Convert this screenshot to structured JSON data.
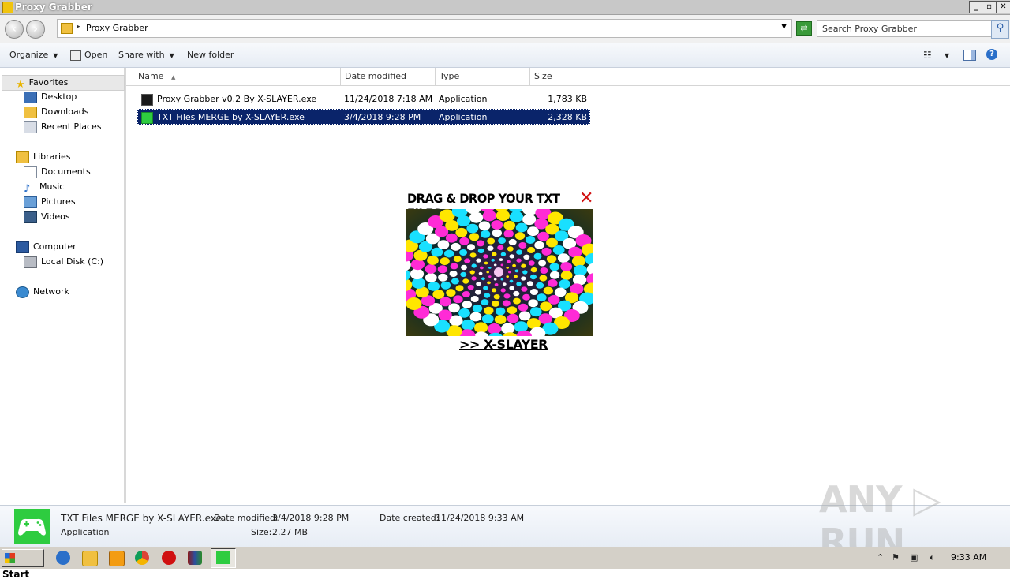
{
  "window": {
    "title": "Proxy Grabber",
    "controls": {
      "minimize": "_",
      "maximize": "▫",
      "close": "✕"
    }
  },
  "address": {
    "breadcrumb": "Proxy Grabber",
    "search_placeholder": "Search Proxy Grabber"
  },
  "toolbar": {
    "organize": "Organize",
    "open": "Open",
    "share_with": "Share with",
    "new_folder": "New folder"
  },
  "nav": {
    "favorites": "Favorites",
    "desktop": "Desktop",
    "downloads": "Downloads",
    "recent_places": "Recent Places",
    "libraries": "Libraries",
    "documents": "Documents",
    "music": "Music",
    "pictures": "Pictures",
    "videos": "Videos",
    "computer": "Computer",
    "local_disk": "Local Disk (C:)",
    "network": "Network"
  },
  "columns": {
    "name": "Name",
    "date": "Date modified",
    "type": "Type",
    "size": "Size"
  },
  "files": [
    {
      "name": "Proxy Grabber v0.2 By X-SLAYER.exe",
      "date": "11/24/2018 7:18 AM",
      "type": "Application",
      "size": "1,783 KB"
    },
    {
      "name": "TXT Files MERGE by X-SLAYER.exe",
      "date": "3/4/2018 9:28 PM",
      "type": "Application",
      "size": "2,328 KB"
    }
  ],
  "popup": {
    "title": "DRAG & DROP YOUR TXT FILES",
    "close": "✕",
    "link": ">> X-SLAYER"
  },
  "details": {
    "filename": "TXT Files MERGE by X-SLAYER.exe",
    "filetype": "Application",
    "date_modified_label": "Date modified:",
    "date_modified": "3/4/2018 9:28 PM",
    "date_created_label": "Date created:",
    "date_created": "11/24/2018 9:33 AM",
    "size_label": "Size:",
    "size": "2.27 MB"
  },
  "watermark": "ANY ▷ RUN",
  "taskbar": {
    "start": "Start",
    "clock": "9:33 AM"
  },
  "colors": {
    "selection": "#0a246a",
    "accent_green": "#2ecc40",
    "popup_close": "#d01010"
  }
}
